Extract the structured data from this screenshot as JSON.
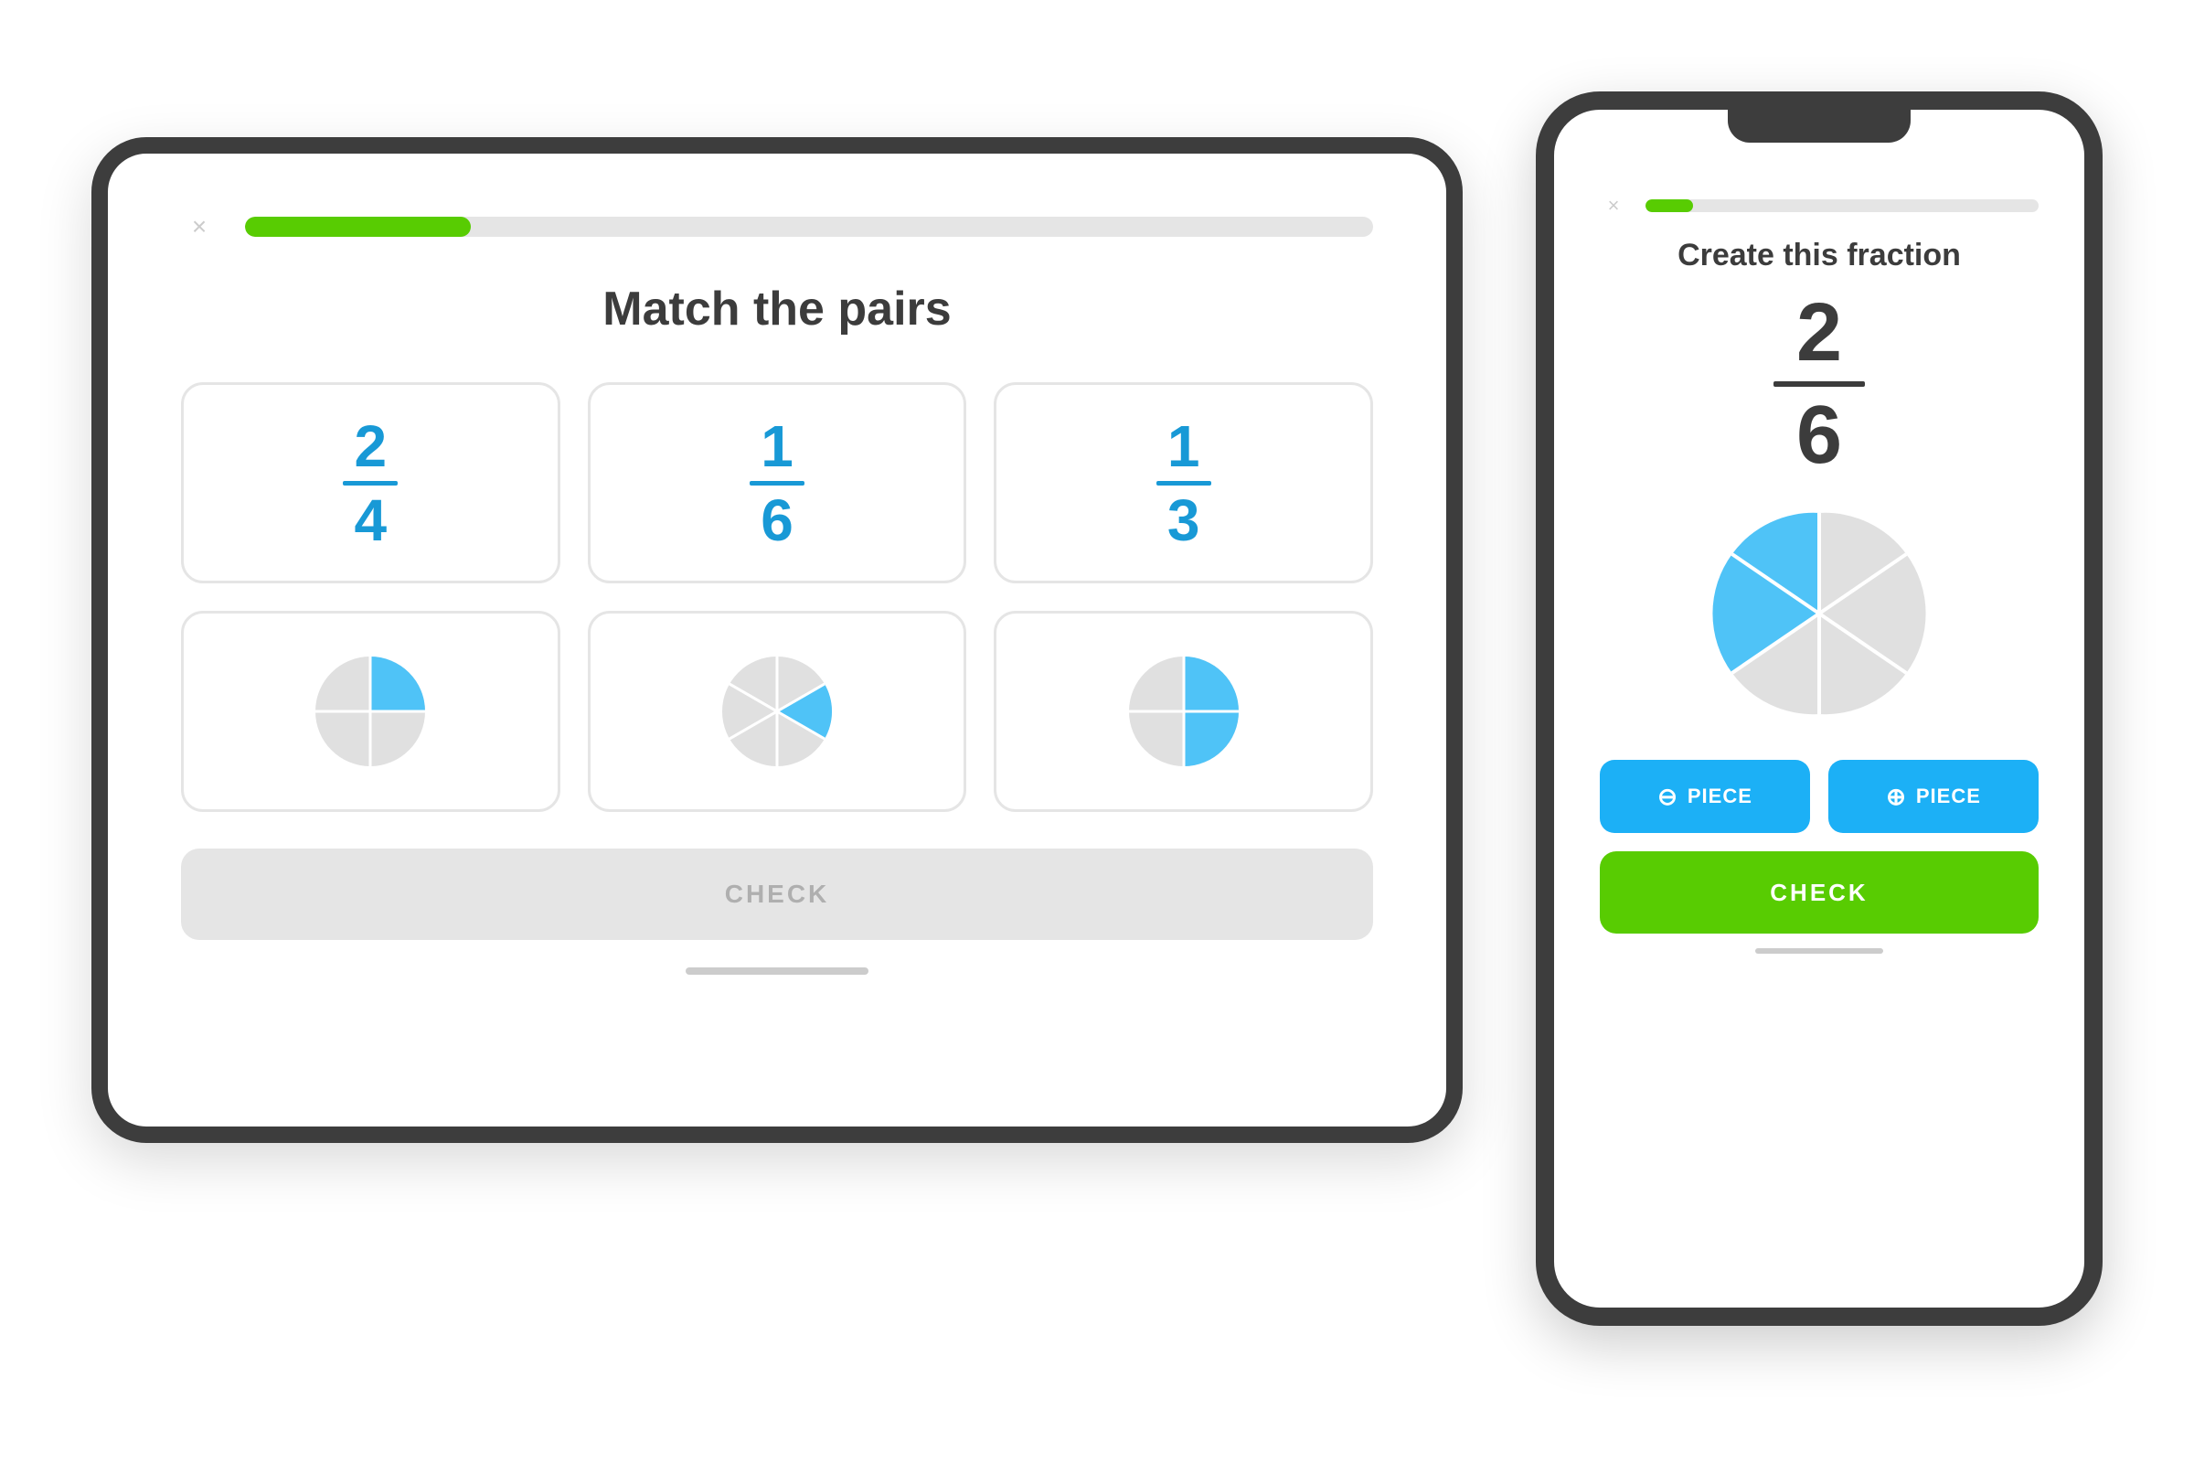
{
  "tablet": {
    "close_icon": "×",
    "progress_percent": 20,
    "title": "Match the pairs",
    "fractions": [
      {
        "numerator": "2",
        "denominator": "4"
      },
      {
        "numerator": "1",
        "denominator": "6"
      },
      {
        "numerator": "1",
        "denominator": "3"
      }
    ],
    "check_label": "CHECK"
  },
  "phone": {
    "close_icon": "×",
    "progress_percent": 12,
    "title": "Create this fraction",
    "fraction": {
      "numerator": "2",
      "denominator": "6"
    },
    "minus_piece_label": "PIECE",
    "plus_piece_label": "PIECE",
    "check_label": "CHECK"
  },
  "colors": {
    "blue": "#1899d6",
    "green": "#58cc02",
    "light_blue": "#1cb0f6",
    "gray_bg": "#e5e5e5",
    "dark_text": "#3c3c3c",
    "border": "#e5e5e5"
  }
}
